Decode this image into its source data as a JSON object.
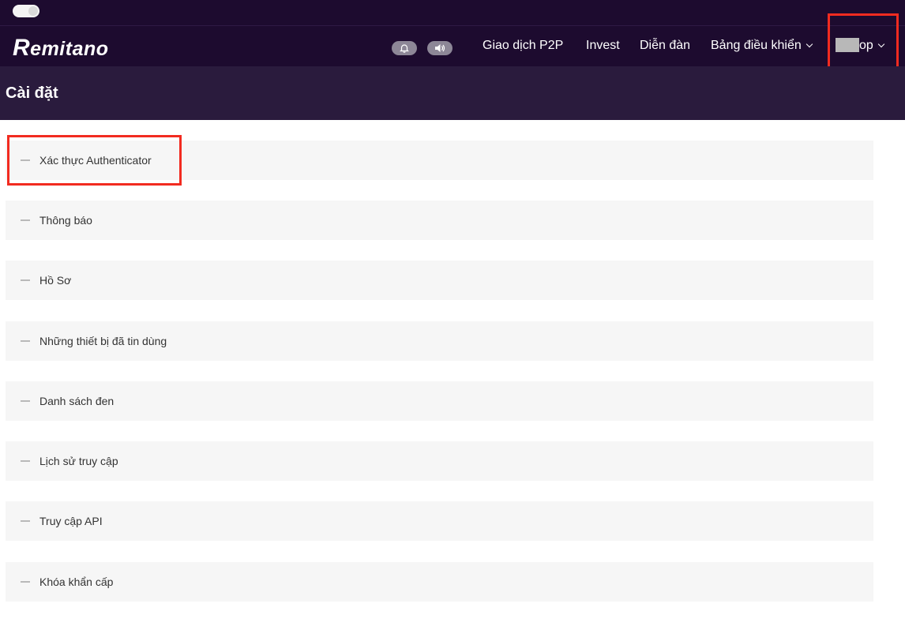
{
  "header": {
    "logo_text": "emitano",
    "logo_initial": "R",
    "nav": {
      "p2p": "Giao dịch P2P",
      "invest": "Invest",
      "forum": "Diễn đàn",
      "dashboard": "Bảng điều khiển"
    },
    "user_label": "op"
  },
  "page": {
    "title": "Cài đặt"
  },
  "settings": {
    "items": [
      {
        "label": "Xác thực Authenticator"
      },
      {
        "label": "Thông báo"
      },
      {
        "label": "Hồ Sơ"
      },
      {
        "label": "Những thiết bị đã tin dùng"
      },
      {
        "label": "Danh sách đen"
      },
      {
        "label": "Lịch sử truy cập"
      },
      {
        "label": "Truy cập API"
      },
      {
        "label": "Khóa khẩn cấp"
      }
    ]
  },
  "colors": {
    "header_bg": "#1d0b2f",
    "subheader_bg": "#2a1b3d",
    "highlight": "#f22b20",
    "row_bg": "#f6f6f6"
  },
  "icons": {
    "bell": "bell-icon",
    "sound": "speaker-icon"
  }
}
